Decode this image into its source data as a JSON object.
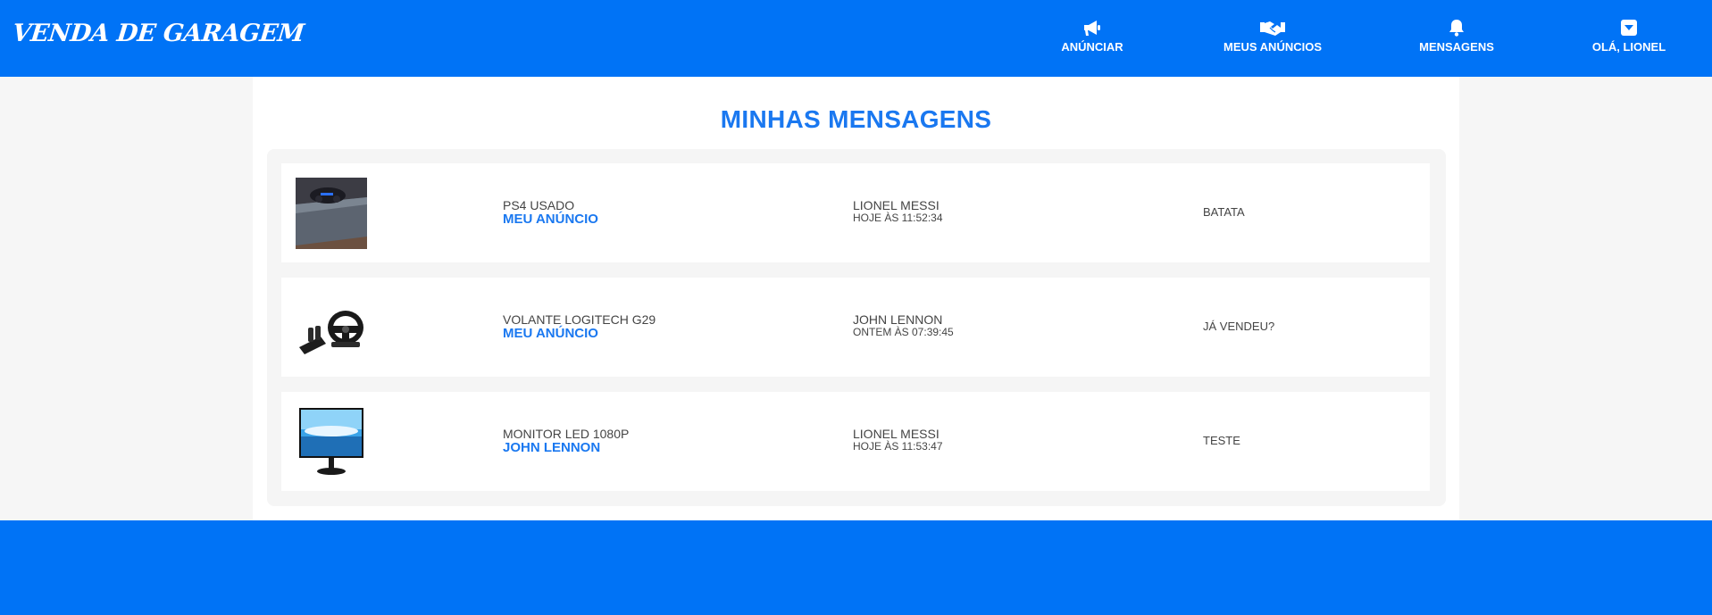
{
  "app": {
    "logo_text": "VENDA DE GARAGEM",
    "accent_color": "#0073f6",
    "link_color": "#1a78f0"
  },
  "nav": {
    "items": [
      {
        "label": "ANÚNCIAR",
        "icon": "megaphone-icon"
      },
      {
        "label": "MEUS ANÚNCIOS",
        "icon": "handshake-icon"
      },
      {
        "label": "MENSAGENS",
        "icon": "bell-icon"
      },
      {
        "label": "OLÁ, LIONEL",
        "icon": "dropdown-caret-icon"
      }
    ]
  },
  "page": {
    "title": "MINHAS MENSAGENS"
  },
  "messages": [
    {
      "product": "PS4 USADO",
      "owner": "MEU ANÚNCIO",
      "sender": "LIONEL MESSI",
      "time": "HOJE ÀS 11:52:34",
      "message": "BATATA",
      "thumbnail": "ps4-console-photo"
    },
    {
      "product": "VOLANTE LOGITECH G29",
      "owner": "MEU ANÚNCIO",
      "sender": "JOHN LENNON",
      "time": "ONTEM ÀS 07:39:45",
      "message": "JÁ VENDEU?",
      "thumbnail": "steering-wheel-photo"
    },
    {
      "product": "MONITOR LED 1080P",
      "owner": "JOHN LENNON",
      "sender": "LIONEL MESSI",
      "time": "HOJE ÀS 11:53:47",
      "message": "TESTE",
      "thumbnail": "monitor-photo"
    }
  ]
}
